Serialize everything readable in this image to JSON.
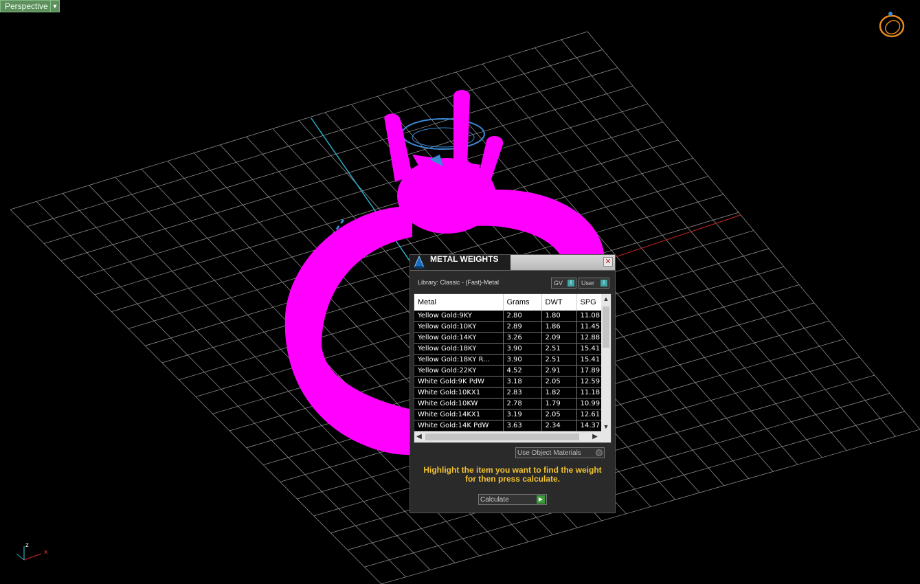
{
  "viewport": {
    "label": "Perspective",
    "axis_x": "x",
    "axis_z": "z",
    "colors": {
      "background": "#000000",
      "grid": "#8a8a8a",
      "model": "#ff00ff",
      "axis_x": "#b02020",
      "axis_y": "#2ab0c8",
      "wire": "#3b8ad6"
    }
  },
  "dialog": {
    "title": "METAL WEIGHTS",
    "library_label": "Library: Classic - (Fast)-Metal",
    "toggle_gv": "GV",
    "toggle_user": "User",
    "columns": [
      "Metal",
      "Grams",
      "DWT",
      "SPG"
    ],
    "rows": [
      [
        "Yellow Gold:9KY",
        "2.80",
        "1.80",
        "11.08"
      ],
      [
        "Yellow Gold:10KY",
        "2.89",
        "1.86",
        "11.45"
      ],
      [
        "Yellow Gold:14KY",
        "3.26",
        "2.09",
        "12.88"
      ],
      [
        "Yellow Gold:18KY",
        "3.90",
        "2.51",
        "15.41"
      ],
      [
        "Yellow Gold:18KY R...",
        "3.90",
        "2.51",
        "15.41"
      ],
      [
        "Yellow Gold:22KY",
        "4.52",
        "2.91",
        "17.89"
      ],
      [
        "White Gold:9K PdW",
        "3.18",
        "2.05",
        "12.59"
      ],
      [
        "White Gold:10KX1",
        "2.83",
        "1.82",
        "11.18"
      ],
      [
        "White Gold:10KW",
        "2.78",
        "1.79",
        "10.99"
      ],
      [
        "White Gold:14KX1",
        "3.19",
        "2.05",
        "12.61"
      ],
      [
        "White Gold:14K PdW",
        "3.63",
        "2.34",
        "14.37"
      ]
    ],
    "use_object_materials": "Use Object Materials",
    "hint": "Highlight the item you want to find the weight for then press calculate.",
    "calculate": "Calculate",
    "colors": {
      "hint": "#f2c230",
      "toggle_knob": "#3ea6a6",
      "go": "#3a9a3a"
    }
  }
}
